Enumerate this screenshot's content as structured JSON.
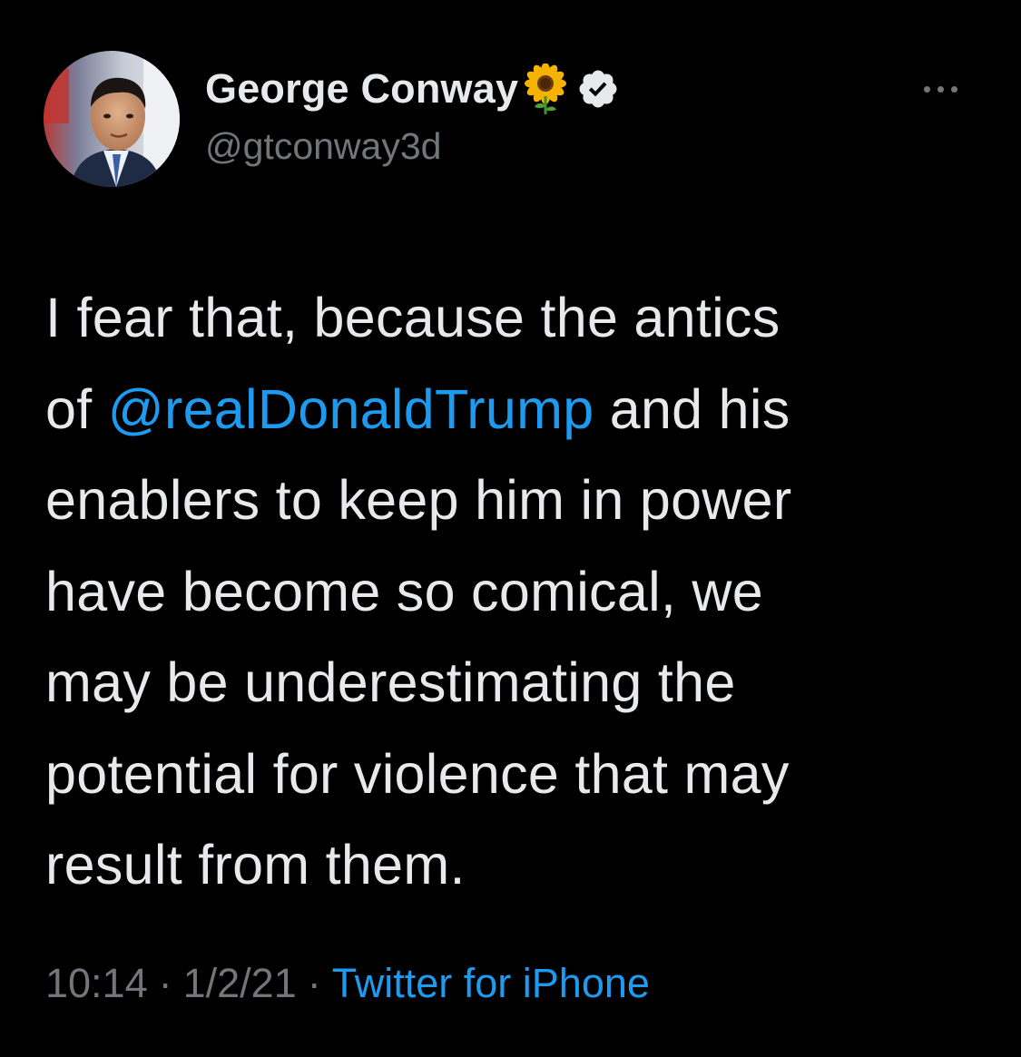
{
  "tweet": {
    "author": {
      "display_name": "George Conway",
      "handle": "@gtconway3d",
      "verified": true,
      "name_emoji": "sunflower-icon"
    },
    "text_lines": [
      [
        "I fear that, because the antics"
      ],
      [
        "of ",
        "@realDonaldTrump",
        " and his"
      ],
      [
        "enablers to keep him in power"
      ],
      [
        "have become so comical, we"
      ],
      [
        "may be underestimating the"
      ],
      [
        "potential for violence that may"
      ],
      [
        "result from them."
      ]
    ],
    "time": "10:14",
    "date": "1/2/21",
    "separator": "·",
    "source": "Twitter for iPhone"
  },
  "colors": {
    "background": "#000000",
    "text": "#e7e9ea",
    "secondary": "#71767b",
    "link": "#1d9bf0"
  }
}
